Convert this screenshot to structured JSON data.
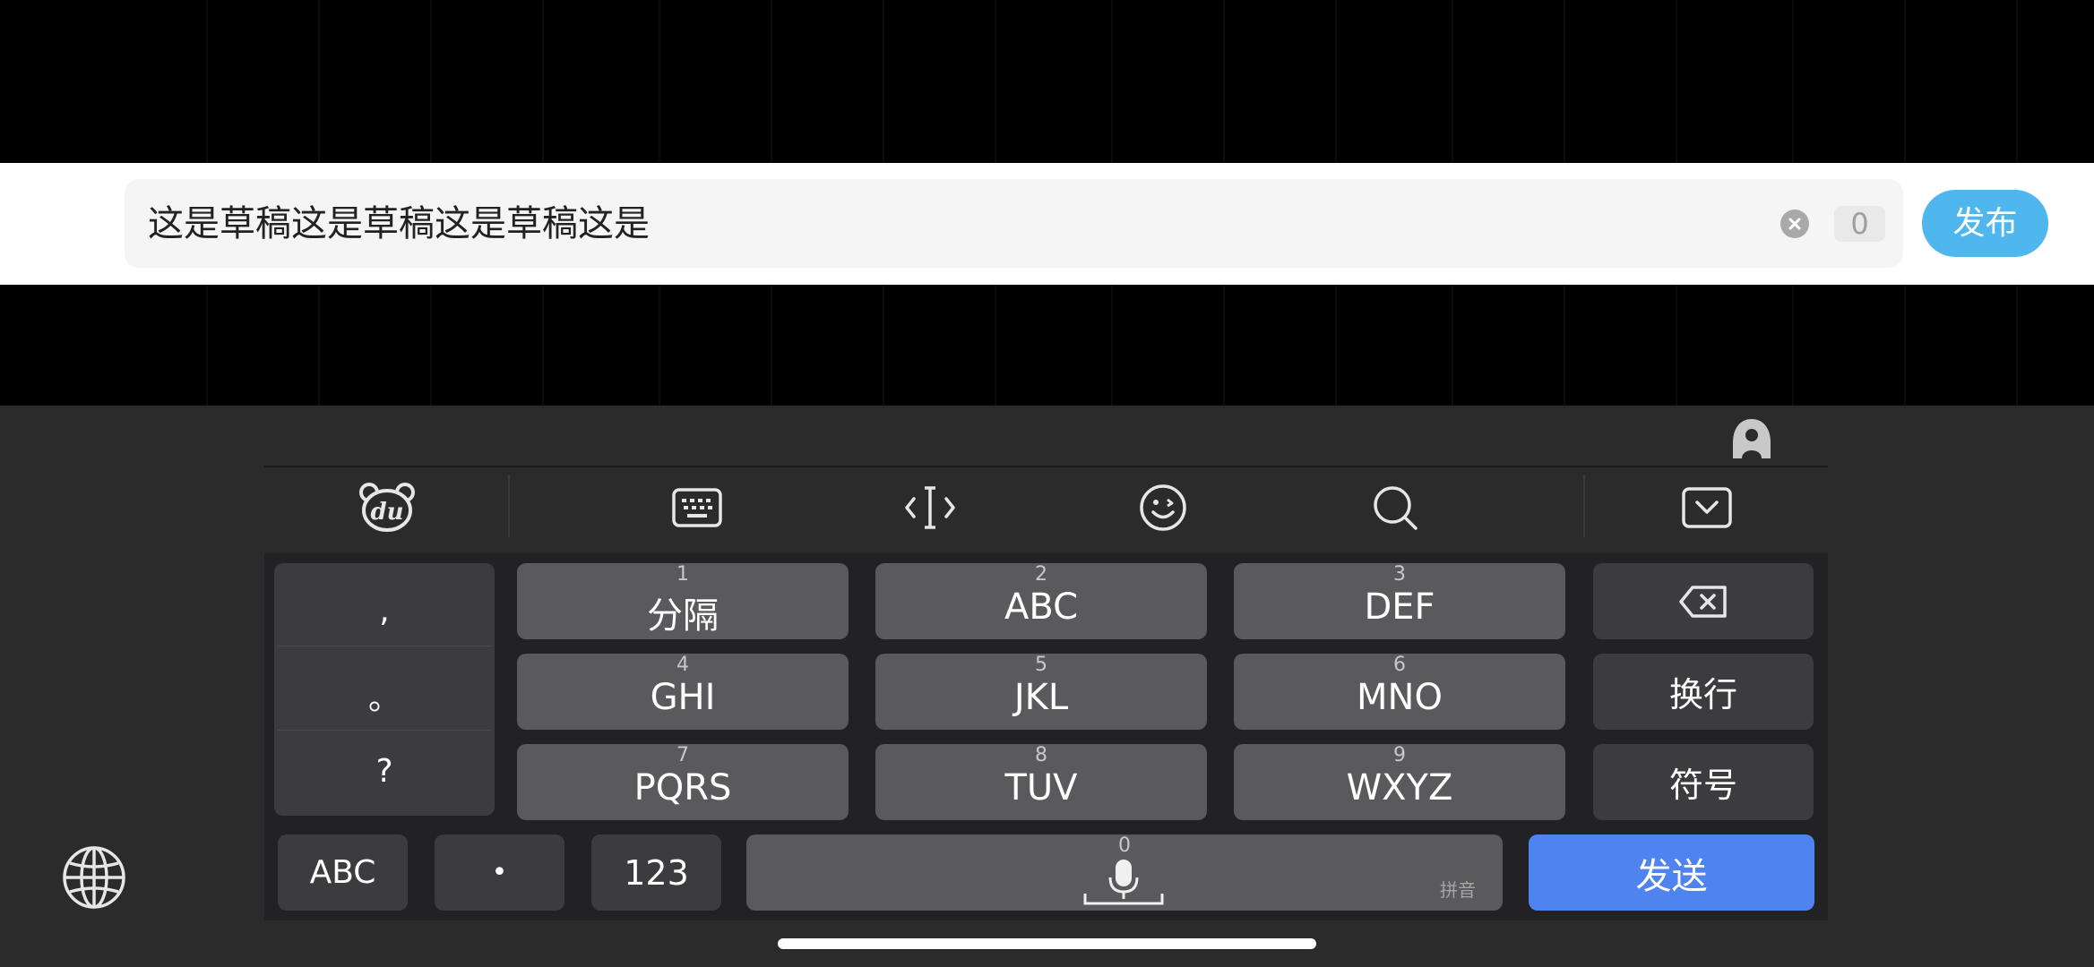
{
  "input": {
    "text": "这是草稿这是草稿这是草稿这是",
    "counter": "0",
    "publish_label": "发布"
  },
  "toolbar": {
    "icons": [
      "du-bear-icon",
      "keyboard-icon",
      "cursor-move-icon",
      "emoji-icon",
      "search-icon",
      "collapse-keyboard-icon"
    ]
  },
  "keyboard": {
    "punctuation": [
      ",",
      "。",
      "?"
    ],
    "keys": [
      {
        "num": "1",
        "label": "分隔"
      },
      {
        "num": "2",
        "label": "ABC"
      },
      {
        "num": "3",
        "label": "DEF"
      },
      {
        "num": "4",
        "label": "GHI"
      },
      {
        "num": "5",
        "label": "JKL"
      },
      {
        "num": "6",
        "label": "MNO"
      },
      {
        "num": "7",
        "label": "PQRS"
      },
      {
        "num": "8",
        "label": "TUV"
      },
      {
        "num": "9",
        "label": "WXYZ"
      }
    ],
    "enter_label": "换行",
    "symbols_label": "符号",
    "abc_label": "ABC",
    "dot_label": "•",
    "num_label": "123",
    "space_num": "0",
    "space_hint": "拼音",
    "send_label": "发送"
  },
  "colors": {
    "accent_blue": "#4f84f0",
    "publish_blue": "#4fb7ee",
    "keyboard_bg": "#2b2b2c"
  }
}
